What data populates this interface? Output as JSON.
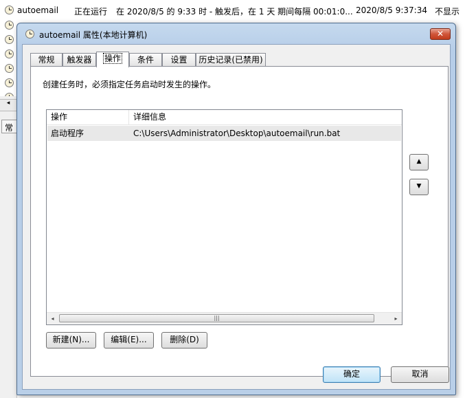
{
  "background": {
    "task_row": {
      "name": "autoemail",
      "status": "正在运行",
      "trigger": "在 2020/8/5 的 9:33 时 - 触发后，在 1 天 期间每隔 00:01:0...",
      "next_run": "2020/8/5 9:37:34",
      "extra": "不显示"
    },
    "side_tab_fragment": "常",
    "scroll_fragment": "◂"
  },
  "dialog": {
    "title": "autoemail 属性(本地计算机)",
    "close_glyph": "✕",
    "tabs": [
      {
        "label": "常规"
      },
      {
        "label": "触发器"
      },
      {
        "label": "操作"
      },
      {
        "label": "条件"
      },
      {
        "label": "设置"
      },
      {
        "label": "历史记录(已禁用)"
      }
    ],
    "active_tab": "操作",
    "description": "创建任务时，必须指定任务启动时发生的操作。",
    "actions_list": {
      "columns": [
        "操作",
        "详细信息"
      ],
      "rows": [
        {
          "action": "启动程序",
          "details": "C:\\Users\\Administrator\\Desktop\\autoemail\\run.bat"
        }
      ],
      "scroll_left": "◂",
      "scroll_right": "▸",
      "scroll_thumb_grip": "|||"
    },
    "move_up_glyph": "▲",
    "move_down_glyph": "▼",
    "buttons": {
      "new": "新建(N)...",
      "edit": "编辑(E)...",
      "delete": "删除(D)",
      "ok": "确定",
      "cancel": "取消"
    }
  }
}
